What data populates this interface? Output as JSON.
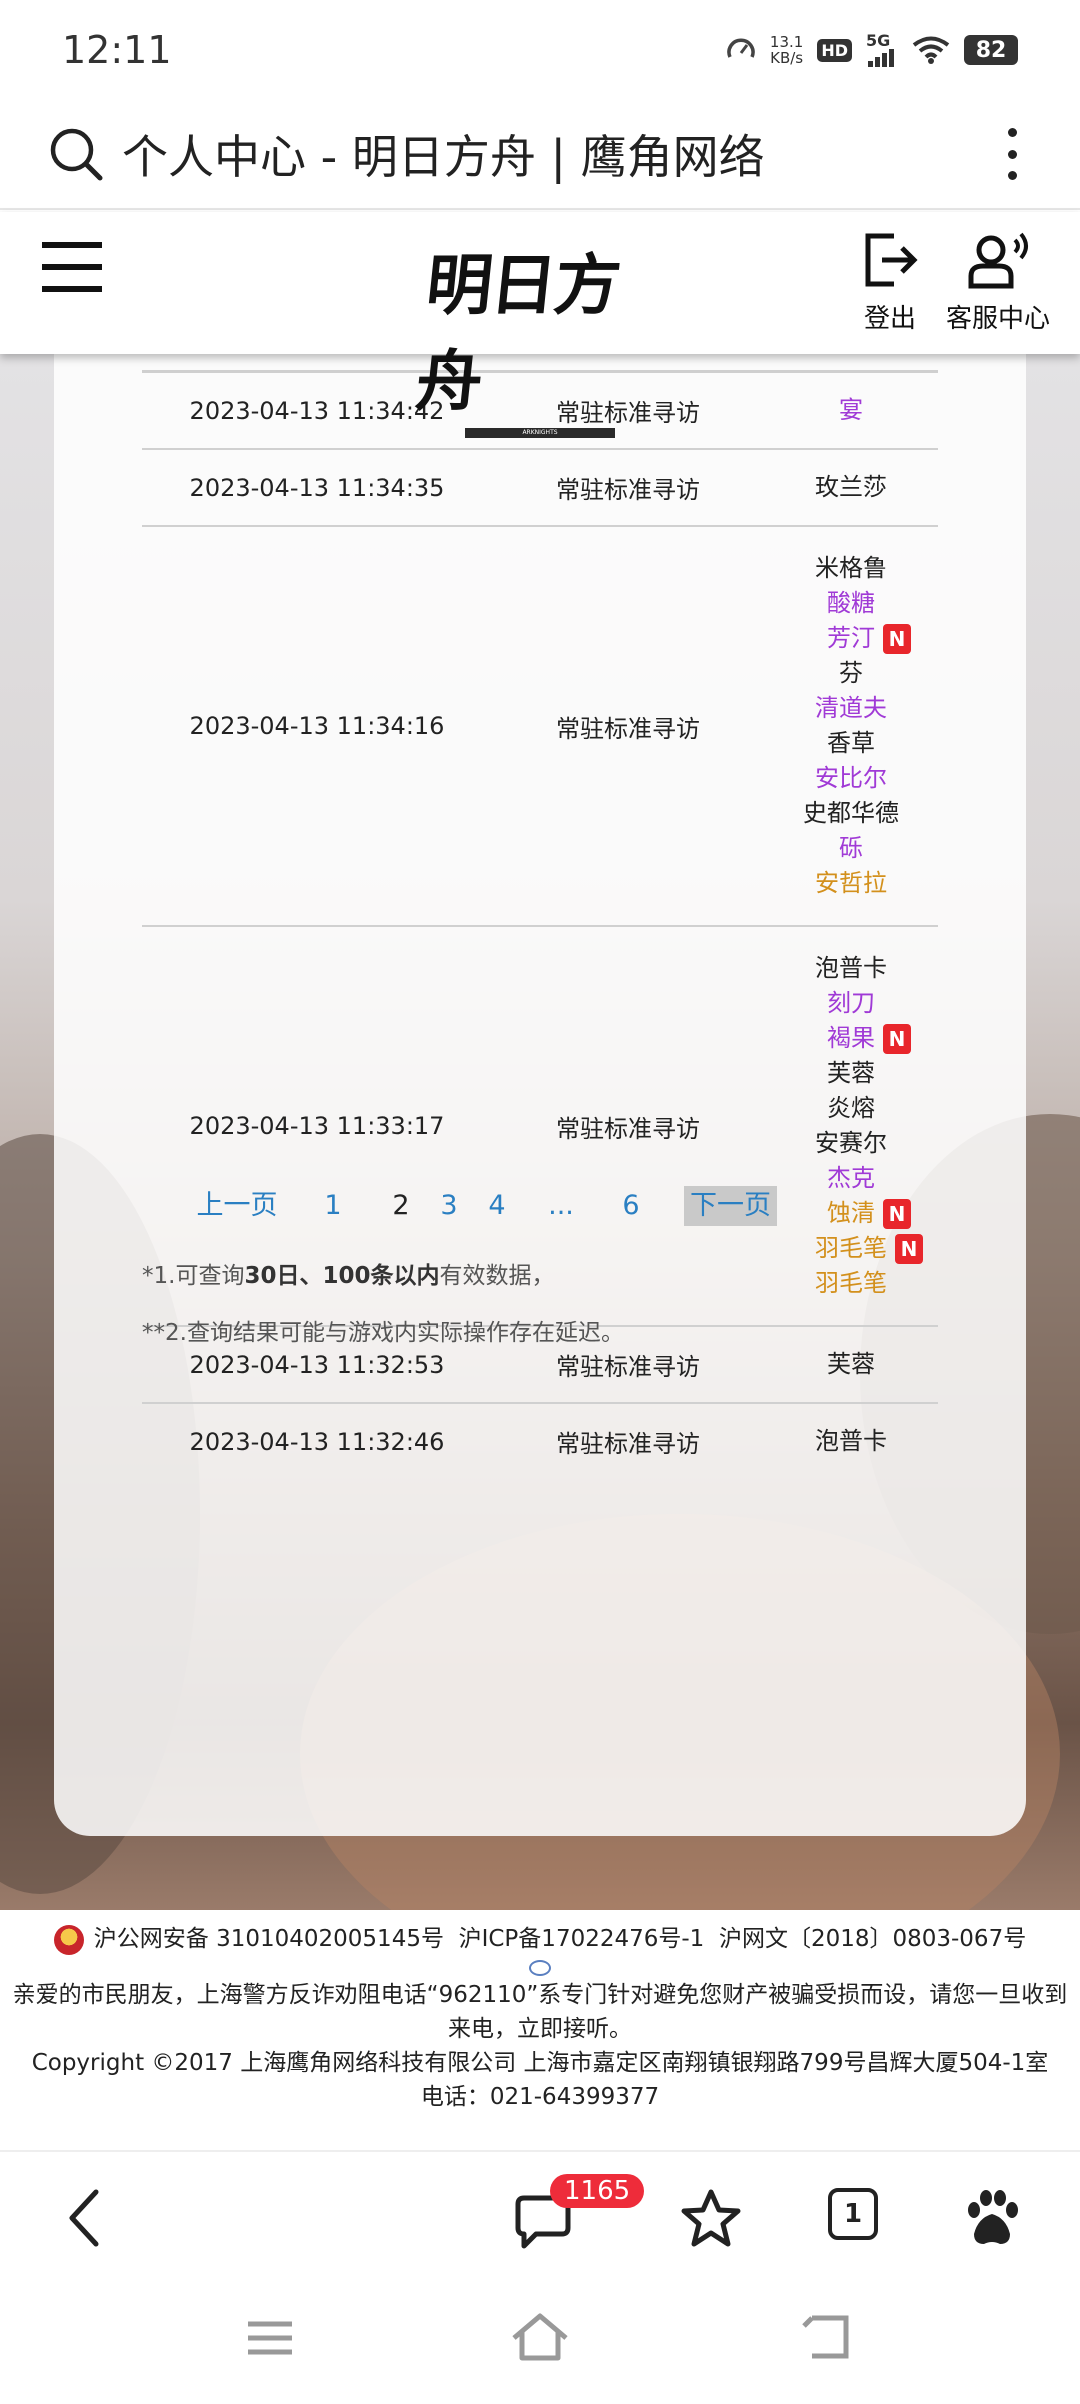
{
  "status_bar": {
    "time": "12:11",
    "net_speed_value": "13.1",
    "net_speed_unit": "KB/s",
    "hd": "HD",
    "network": "5G",
    "battery": "82"
  },
  "browser": {
    "page_title": "个人中心 - 明日方舟 | 鹰角网络"
  },
  "site_header": {
    "logo_text": "明日方舟",
    "logo_sub": "ARKNIGHTS",
    "logout_label": "登出",
    "service_label": "客服中心"
  },
  "records": [
    {
      "time": "2023-04-13 11:34:42",
      "pool": "常驻标准寻访",
      "operators": [
        {
          "name": "宴",
          "rarity": "r4",
          "new": false
        }
      ]
    },
    {
      "time": "2023-04-13 11:34:35",
      "pool": "常驻标准寻访",
      "operators": [
        {
          "name": "玫兰莎",
          "rarity": "r3",
          "new": false
        }
      ]
    },
    {
      "time": "2023-04-13 11:34:16",
      "pool": "常驻标准寻访",
      "operators": [
        {
          "name": "米格鲁",
          "rarity": "r3",
          "new": false
        },
        {
          "name": "酸糖",
          "rarity": "r4",
          "new": false
        },
        {
          "name": "芳汀",
          "rarity": "r4",
          "new": true
        },
        {
          "name": "芬",
          "rarity": "r3",
          "new": false
        },
        {
          "name": "清道夫",
          "rarity": "r4",
          "new": false
        },
        {
          "name": "香草",
          "rarity": "r3",
          "new": false
        },
        {
          "name": "安比尔",
          "rarity": "r4",
          "new": false
        },
        {
          "name": "史都华德",
          "rarity": "r3",
          "new": false
        },
        {
          "name": "砾",
          "rarity": "r4",
          "new": false
        },
        {
          "name": "安哲拉",
          "rarity": "r5",
          "new": false
        }
      ]
    },
    {
      "time": "2023-04-13 11:33:17",
      "pool": "常驻标准寻访",
      "operators": [
        {
          "name": "泡普卡",
          "rarity": "r3",
          "new": false
        },
        {
          "name": "刻刀",
          "rarity": "r4",
          "new": false
        },
        {
          "name": "褐果",
          "rarity": "r4",
          "new": true
        },
        {
          "name": "芙蓉",
          "rarity": "r3",
          "new": false
        },
        {
          "name": "炎熔",
          "rarity": "r3",
          "new": false
        },
        {
          "name": "安赛尔",
          "rarity": "r3",
          "new": false
        },
        {
          "name": "杰克",
          "rarity": "r4",
          "new": false
        },
        {
          "name": "蚀清",
          "rarity": "r5",
          "new": true
        },
        {
          "name": "羽毛笔",
          "rarity": "r5",
          "new": true
        },
        {
          "name": "羽毛笔",
          "rarity": "r5",
          "new": false
        }
      ]
    },
    {
      "time": "2023-04-13 11:32:53",
      "pool": "常驻标准寻访",
      "operators": [
        {
          "name": "芙蓉",
          "rarity": "r3",
          "new": false
        }
      ]
    },
    {
      "time": "2023-04-13 11:32:46",
      "pool": "常驻标准寻访",
      "operators": [
        {
          "name": "泡普卡",
          "rarity": "r3",
          "new": false
        }
      ]
    }
  ],
  "new_badge": "N",
  "rarity_colors": {
    "r3": "#222222",
    "r4": "#a03ad6",
    "r5": "#d3901c",
    "new_badge": "#e8262b"
  },
  "pagination": {
    "prev": "上一页",
    "pages": [
      "1",
      "2",
      "3",
      "4",
      "...",
      "6"
    ],
    "current_page": "2",
    "next": "下一页"
  },
  "notes": {
    "note1_prefix": "*1.可查询",
    "note1_bold": "30日、100条以内",
    "note1_suffix": "有效数据，",
    "note2": "**2.查询结果可能与游戏内实际操作存在延迟。"
  },
  "footer": {
    "beian": "沪公网安备 31010402005145号",
    "icp": "沪ICP备17022476号-1",
    "wenwang": "沪网文〔2018〕0803-067号",
    "antifraud": "亲爱的市民朋友，上海警方反诈劝阻电话“962110”系专门针对避免您财产被骗受损而设，请您一旦收到来电，立即接听。",
    "copyright": "Copyright ©2017 上海鹰角网络科技有限公司  上海市嘉定区南翔镇银翔路799号昌辉大厦504-1室",
    "phone": "电话：021-64399377"
  },
  "toolbar": {
    "message_count": "1165",
    "tab_count": "1"
  }
}
